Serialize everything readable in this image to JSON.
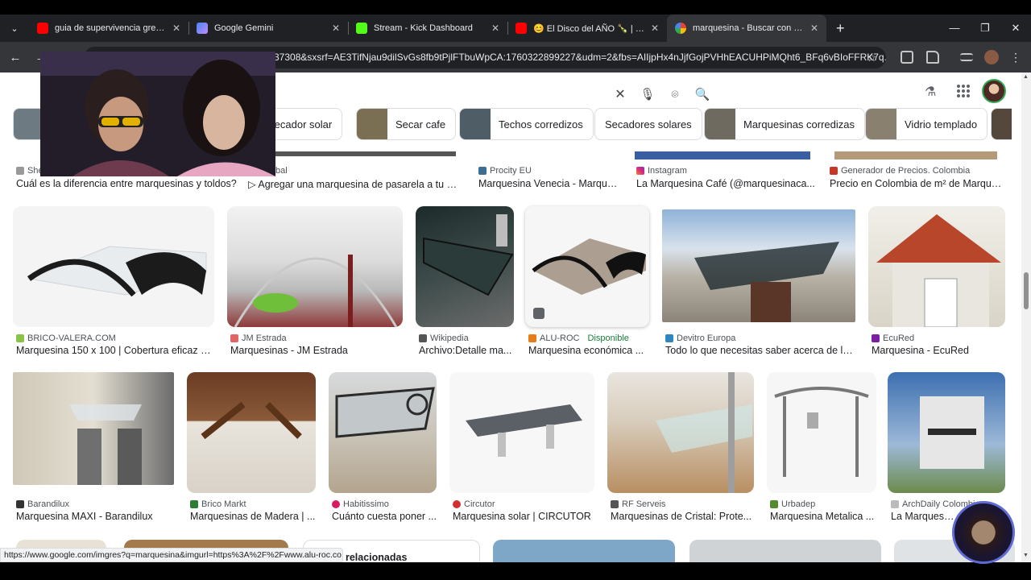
{
  "browser": {
    "tabs": [
      {
        "title": "guia de supervivencia green he",
        "favicon_color": "#ff0000",
        "active": false
      },
      {
        "title": "Google Gemini",
        "favicon_color": "#8ab4f8",
        "active": false
      },
      {
        "title": "Stream - Kick Dashboard",
        "favicon_color": "#53fc18",
        "active": false
      },
      {
        "title": "😊 El Disco del AÑO 🍾 | 🪄 C",
        "favicon_color": "#ff0000",
        "active": false
      },
      {
        "title": "marquesina - Buscar con Googl",
        "favicon_color": "#ffffff",
        "active": true
      }
    ],
    "new_tab_label": "+",
    "url": "37308&sxsrf=AE3TifNjau9dilSvGs8fb9tPjlFTbuWpCA:1760322899227&udm=2&fbs=AIIjpHx4nJjfGojPVHhEACUHPiMQht6_BFq6vBIoFFRK7q...",
    "status_url": "https://www.google.com/imgres?q=marquesina&imgurl=https%3A%2F%2Fwww.alu-roc.co..."
  },
  "search": {
    "chips": [
      {
        "label": "Secador solar",
        "img": "#5b6a78"
      },
      {
        "label": "Secar cafe",
        "img": "#7a6f52"
      },
      {
        "label": "Techos corredizos",
        "img": "#4e5d66"
      },
      {
        "label": "Secadores solares",
        "img": ""
      },
      {
        "label": "Marquesinas corredizas",
        "img": "#6f6a60"
      },
      {
        "label": "Vidrio templado",
        "img": "#8a8070"
      }
    ],
    "row0": [
      {
        "source": "She",
        "title": "Cuál es la diferencia entre marquesinas y toldos?"
      },
      {
        "source": "bal",
        "title": "▷ Agregar una marquesina de pasarela a tu di..."
      },
      {
        "source": "Procity EU",
        "title": "Marquesina Venecia - Marque..."
      },
      {
        "source": "Instagram",
        "title": "La Marquesina Café (@marquesinaca..."
      },
      {
        "source": "Generador de Precios. Colombia",
        "title": "Precio en Colombia de m² de Marque..."
      }
    ],
    "row1": [
      {
        "source": "BRICO-VALERA.COM",
        "title": "Marquesina 150 x 100 | Cobertura eficaz e..."
      },
      {
        "source": "JM Estrada",
        "title": "Marquesinas - JM Estrada"
      },
      {
        "source": "Wikipedia",
        "title": "Archivo:Detalle ma..."
      },
      {
        "source": "ALU-ROC",
        "title": "Marquesina económica ...",
        "badge": "Disponible"
      },
      {
        "source": "Devitro Europa",
        "title": "Todo lo que necesitas saber acerca de la..."
      },
      {
        "source": "EcuRed",
        "title": "Marquesina - EcuRed"
      }
    ],
    "row2": [
      {
        "source": "Barandilux",
        "title": "Marquesina MAXI - Barandilux"
      },
      {
        "source": "Brico Markt",
        "title": "Marquesinas de Madera | ..."
      },
      {
        "source": "Habitissimo",
        "title": "Cuánto cuesta poner ..."
      },
      {
        "source": "Circutor",
        "title": "Marquesina solar | CIRCUTOR"
      },
      {
        "source": "RF Serveis",
        "title": "Marquesinas de Cristal: Prote..."
      },
      {
        "source": "Urbadep",
        "title": "Marquesina Metalica ..."
      },
      {
        "source": "ArchDaily Colombi",
        "title": "La Marquesina..."
      }
    ],
    "related_label": "edas relacionadas"
  }
}
